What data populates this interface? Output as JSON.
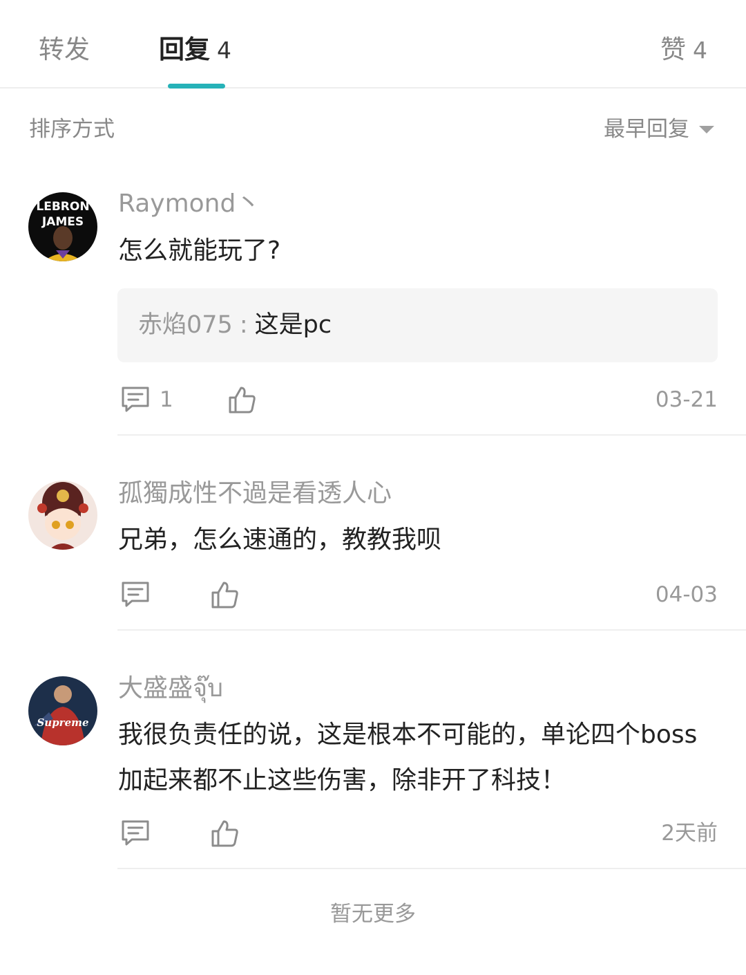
{
  "tabs": {
    "forward": {
      "label": "转发"
    },
    "reply": {
      "label": "回复",
      "count": "4"
    },
    "like": {
      "label": "赞",
      "count": "4"
    },
    "active": "reply",
    "accent_color": "#26b2b8"
  },
  "sort": {
    "label": "排序方式",
    "selected": "最早回复"
  },
  "comments": [
    {
      "username": "Raymond丶",
      "avatar_text": [
        "LEBRON",
        "JAMES"
      ],
      "text": "怎么就能玩了?",
      "quote": {
        "name": "赤焰075",
        "separator": ":",
        "text": "这是pc"
      },
      "reply_count": "1",
      "date": "03-21"
    },
    {
      "username": "孤獨成性不過是看透人心",
      "text": "兄弟，怎么速通的，教教我呗",
      "date": "04-03"
    },
    {
      "username": "大盛盛จุ๊บ",
      "avatar_text": "Supreme",
      "text": "我很负责任的说，这是根本不可能的，单论四个boss加起来都不止这些伤害，除非开了科技！",
      "date": "2天前"
    }
  ],
  "icons": {
    "comment": "comment-bubble-icon",
    "like": "thumbs-up-icon",
    "sort": "caret-down-icon"
  },
  "footer": "暂无更多"
}
